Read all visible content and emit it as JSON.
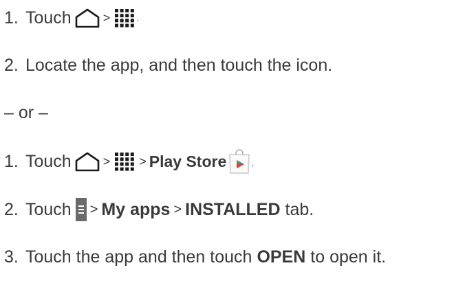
{
  "steps_a": [
    {
      "num": "1.",
      "text": "Touch",
      "sep": ">",
      "period": "."
    },
    {
      "num": "2.",
      "text": "Locate the app, and then touch the icon."
    }
  ],
  "divider": "– or –",
  "steps_b": [
    {
      "num": "1.",
      "text": "Touch",
      "sep1": ">",
      "sep2": ">",
      "bold": "Play Store",
      "period": "."
    },
    {
      "num": "2.",
      "text": "Touch",
      "sep1": ">",
      "bold1": "My apps",
      "sep2": ">",
      "bold2": "INSTALLED",
      "tail": "tab."
    },
    {
      "num": "3.",
      "text": "Touch the app and then touch",
      "bold": "OPEN",
      "tail": "to open it."
    }
  ],
  "icons": {
    "home": "home-icon",
    "apps": "apps-grid-icon",
    "play_store": "play-store-icon",
    "menu": "menu-icon"
  },
  "colors": {
    "text": "#3a3a3a",
    "icon_dark": "#1a1a1a",
    "menu_gray": "#666666",
    "play_blue": "#2b8fd6",
    "play_red": "#e53935"
  }
}
